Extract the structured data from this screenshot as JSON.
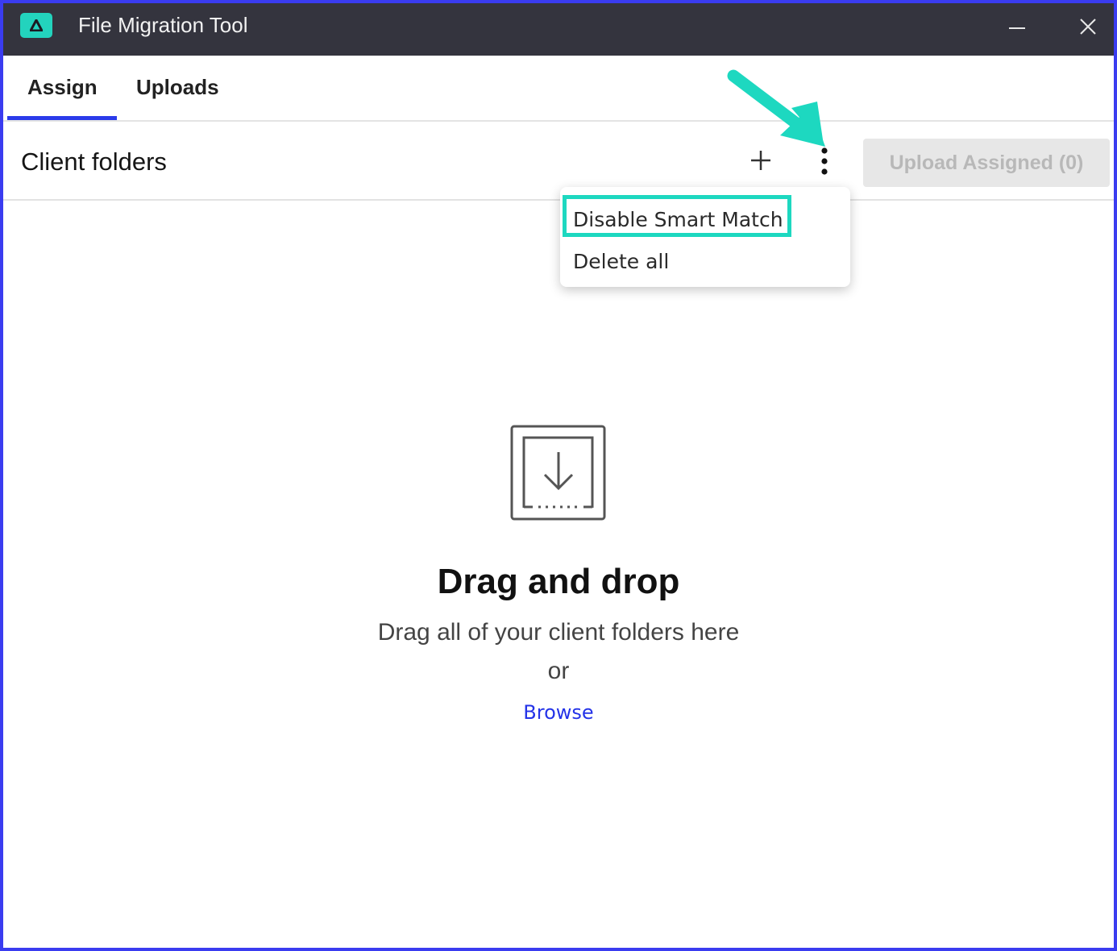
{
  "window": {
    "title": "File Migration Tool",
    "logo_icon": "delta-logo-icon",
    "minimize_icon": "minimize-icon",
    "close_icon": "close-icon"
  },
  "tabs": [
    {
      "label": "Assign",
      "active": true
    },
    {
      "label": "Uploads",
      "active": false
    }
  ],
  "toolbar": {
    "section_title": "Client folders",
    "add_icon": "plus-icon",
    "more_icon": "vertical-dots-icon",
    "upload_label": "Upload Assigned (0)",
    "upload_disabled": true
  },
  "menu": {
    "items": [
      {
        "label": "Disable Smart Match",
        "highlighted": true
      },
      {
        "label": "Delete all",
        "highlighted": false
      }
    ]
  },
  "dropzone": {
    "icon": "download-tray-icon",
    "title": "Drag and drop",
    "subtitle": "Drag all of your client folders here",
    "or": "or",
    "browse": "Browse"
  },
  "colors": {
    "titlebar": "#34343e",
    "accent": "#2b3bea",
    "annotation": "#1dd8c0",
    "logo": "#23d3bd"
  }
}
